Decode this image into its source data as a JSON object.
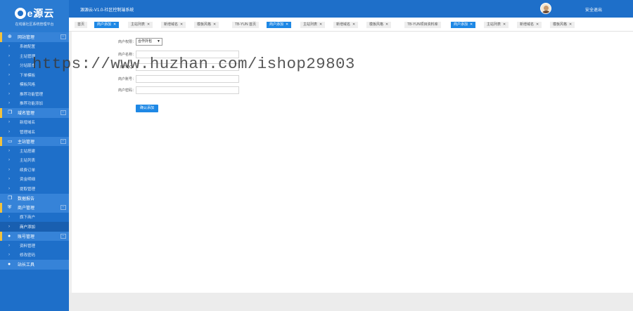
{
  "brand": {
    "name": "e源云",
    "slogan": "在线版社区系统管理平台"
  },
  "header": {
    "title": "源源云-V1.0-社区控制端系统",
    "logout": "安全退出"
  },
  "tabs": [
    {
      "label": "首页",
      "active": false,
      "closable": false
    },
    {
      "label": "商户添加",
      "active": true,
      "closable": true
    },
    {
      "label": "主站列表",
      "active": false,
      "closable": true
    },
    {
      "label": "新增域名",
      "active": false,
      "closable": true
    },
    {
      "label": "模板风格",
      "active": false,
      "closable": true
    },
    {
      "label": "TB-YUN 首页",
      "active": false,
      "closable": false
    },
    {
      "label": "商户添加",
      "active": true,
      "closable": true
    },
    {
      "label": "主站列表",
      "active": false,
      "closable": true
    },
    {
      "label": "新增域名",
      "active": false,
      "closable": true
    },
    {
      "label": "模板风格",
      "active": false,
      "closable": true
    },
    {
      "label": "TB-YUN项目资料库",
      "active": false,
      "closable": false
    },
    {
      "label": "商户添加",
      "active": true,
      "closable": true
    },
    {
      "label": "主站列表",
      "active": false,
      "closable": true
    },
    {
      "label": "新增域名",
      "active": false,
      "closable": true
    },
    {
      "label": "模板风格",
      "active": false,
      "closable": true
    }
  ],
  "sidebar": {
    "groups": [
      {
        "label": "网站管理",
        "icon": "globe-icon",
        "items": [
          "系统配置",
          "主站管理",
          "分站版本",
          "下单模板",
          "模板风格",
          "推荐功能管理",
          "推荐功能添加"
        ]
      },
      {
        "label": "域名管理",
        "icon": "copy-icon",
        "items": [
          "新增域名",
          "管理域名"
        ]
      },
      {
        "label": "主站管理",
        "icon": "monitor-icon",
        "items": [
          "主站搭建",
          "主站列表",
          "续费订单",
          "资金明细",
          "提取管理"
        ]
      },
      {
        "label": "数据报告",
        "icon": "copy-icon",
        "items": []
      },
      {
        "label": "商户管理",
        "icon": "shield-icon",
        "items": [
          "旗下商户",
          "商户添加"
        ]
      },
      {
        "label": "账号管理",
        "icon": "user-icon",
        "items": [
          "资料管理",
          "修改密码"
        ]
      },
      {
        "label": "站长工具",
        "icon": "user-icon",
        "items": []
      }
    ],
    "active_item": "商户添加"
  },
  "form": {
    "permission_label": "商户权限：",
    "permission_value": "合作外包",
    "name_label": "商户名称：",
    "hidden_label": "商户QQ：",
    "account_label": "商户账号：",
    "password_label": "商户密码：",
    "submit_label": "确认添加"
  },
  "watermark": "https://www.huzhan.com/ishop29803"
}
